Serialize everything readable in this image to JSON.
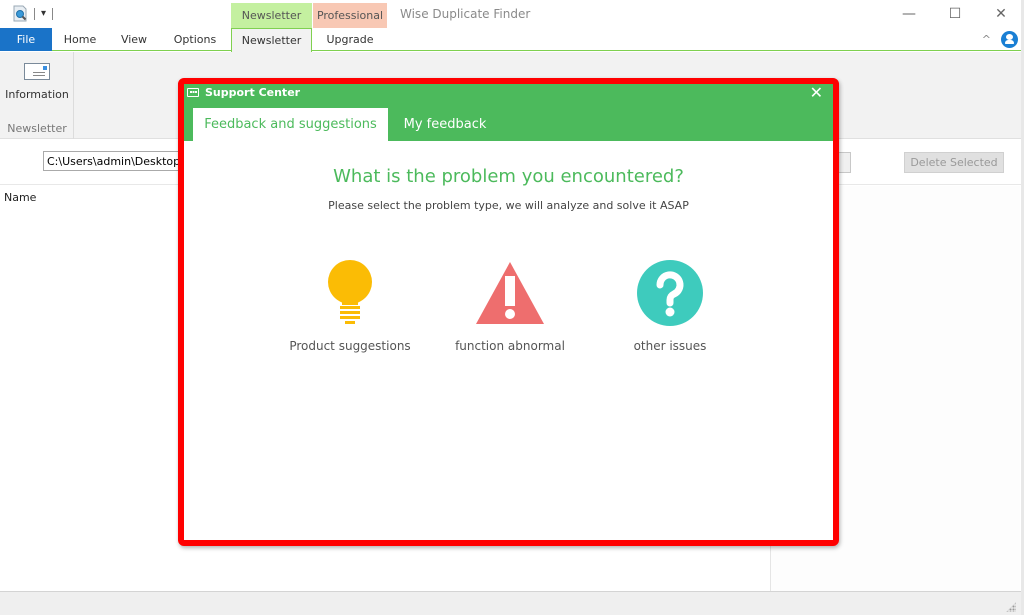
{
  "window": {
    "title": "Wise Duplicate Finder",
    "controls": {
      "minimize": "—",
      "maximize": "☐",
      "close": "✕"
    }
  },
  "quick_access": {
    "dropdown_glyph": "▾"
  },
  "contextual_tabs": {
    "newsletter": "Newsletter",
    "professional": "Professional"
  },
  "ribbon": {
    "tabs": [
      {
        "label": "File"
      },
      {
        "label": "Home"
      },
      {
        "label": "View"
      },
      {
        "label": "Options"
      },
      {
        "label": "Newsletter"
      },
      {
        "label": "Upgrade"
      }
    ],
    "active_tab": "Newsletter",
    "collapse_glyph": "^",
    "group": {
      "button_label": "Information",
      "group_label": "Newsletter"
    }
  },
  "toolbar": {
    "path_value": "C:\\Users\\admin\\Desktop\\Des",
    "delete_selected_label": "Delete Selected"
  },
  "list": {
    "column_name": "Name"
  },
  "dialog": {
    "title": "Support Center",
    "close_glyph": "✕",
    "tabs": [
      {
        "label": "Feedback and suggestions",
        "active": true
      },
      {
        "label": "My feedback",
        "active": false
      }
    ],
    "heading": "What is the problem you encountered?",
    "subheading": "Please select the problem type, we will analyze and solve it ASAP",
    "options": [
      {
        "label": "Product suggestions",
        "icon": "lightbulb-icon",
        "color": "#fbbc05"
      },
      {
        "label": "function abnormal",
        "icon": "warning-triangle-icon",
        "color": "#ee6e6e"
      },
      {
        "label": "other issues",
        "icon": "question-circle-icon",
        "color": "#3ecbbd"
      }
    ]
  },
  "colors": {
    "accent_green": "#4cba5c",
    "file_tab_blue": "#1a73c8",
    "highlight_red": "#ff0000",
    "newsletter_ctx": "#c4f0a0",
    "professional_ctx": "#f8c8b4"
  }
}
